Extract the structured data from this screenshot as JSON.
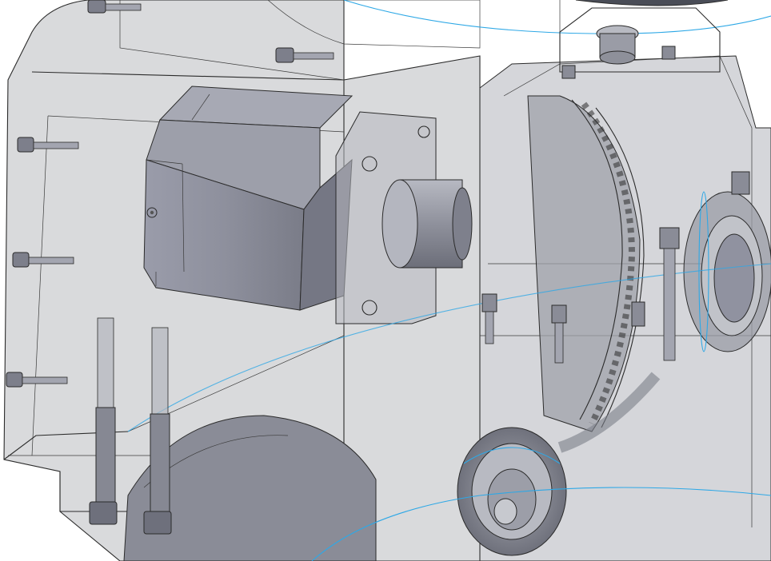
{
  "scene": {
    "kind": "cad-assembly-render",
    "style": "transparent-shaded",
    "colors": {
      "background": "#ffffff",
      "housing_glass": "#9ea1a6",
      "metal": "#8d909c",
      "metal_dark": "#6e717d",
      "edge": "#2b2b2b",
      "highlight_blue": "#2ea8e6"
    },
    "visible_text": []
  }
}
